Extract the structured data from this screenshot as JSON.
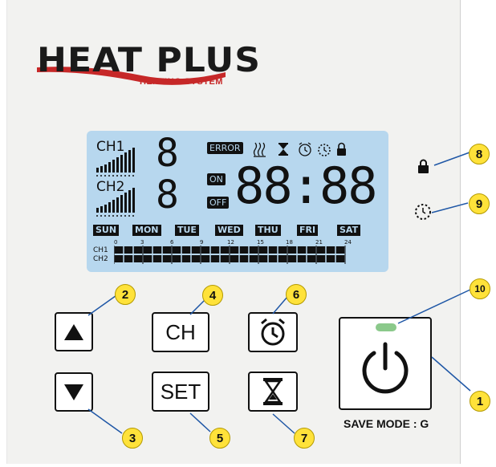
{
  "logo": {
    "main": "HEAT PLUS",
    "sub": "HEATING SYSTEM"
  },
  "lcd": {
    "ch1_label": "CH1",
    "ch2_label": "CH2",
    "ch1_digit": "8",
    "ch2_digit": "8",
    "error_label": "ERROR",
    "on_label": "ON",
    "off_label": "OFF",
    "clock": "88:88",
    "days": [
      "SUN",
      "MON",
      "TUE",
      "WED",
      "THU",
      "FRI",
      "SAT"
    ],
    "hour_ticks": [
      "0",
      "3",
      "6",
      "9",
      "12",
      "15",
      "18",
      "21",
      "24"
    ],
    "row_labels": [
      "CH1",
      "CH2"
    ]
  },
  "buttons": {
    "ch_label": "CH",
    "set_label": "SET",
    "save_mode": "SAVE MODE : G"
  },
  "callouts": {
    "power": "1",
    "up": "2",
    "down": "3",
    "ch": "4",
    "set": "5",
    "alarm": "6",
    "timer": "7",
    "lock": "8",
    "schedule": "9",
    "led": "10"
  },
  "colors": {
    "lcd": "#b7d7ee",
    "callout": "#ffe23a",
    "led": "#8bc98b",
    "logo_accent": "#c62828"
  }
}
